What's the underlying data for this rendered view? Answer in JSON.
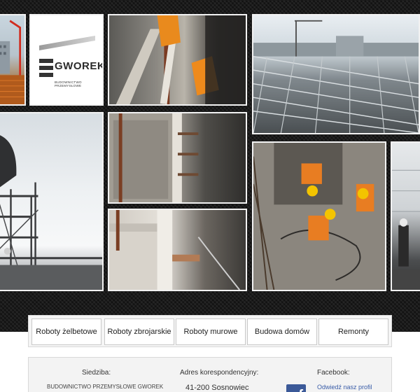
{
  "logo": {
    "name": "GWOREK",
    "subtitle": "BUDOWNICTWO PRZEMYSŁOWE"
  },
  "nav": {
    "items": [
      {
        "label": "Roboty żelbetowe"
      },
      {
        "label": "Roboty zbrojarskie"
      },
      {
        "label": "Roboty murowe"
      },
      {
        "label": "Budowa domów"
      },
      {
        "label": "Remonty"
      }
    ]
  },
  "footer": {
    "seat": {
      "heading": "Siedziba:",
      "line1": "BUDOWNICTWO PRZEMYSŁOWE GWOREK"
    },
    "address": {
      "heading": "Adres korespondencyjny:",
      "line1": "41-200 Sosnowiec"
    },
    "facebook": {
      "heading": "Facebook:",
      "link": "Odwiedź nasz profil",
      "icon": "facebook-icon"
    }
  },
  "colors": {
    "background_dark": "#1a1a1a",
    "facebook_blue": "#3b5998",
    "link_blue": "#3a5da8"
  }
}
